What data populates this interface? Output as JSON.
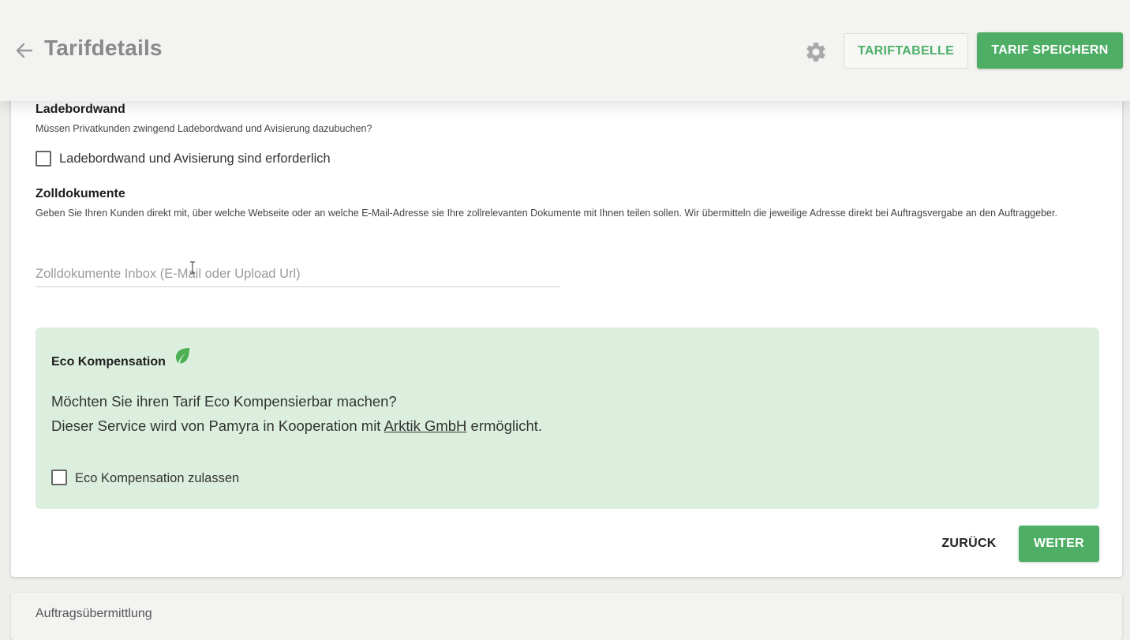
{
  "header": {
    "title": "Tarifdetails",
    "back_icon": "arrow-left-icon",
    "settings_icon": "gear-icon",
    "table_button_label": "TARIFTABELLE",
    "save_button_label": "TARIF SPEICHERN"
  },
  "ladebordwand": {
    "heading": "Ladebordwand",
    "description": "Müssen Privatkunden zwingend Ladebordwand und Avisierung dazubuchen?",
    "checkbox_label": "Ladebordwand und Avisierung sind erforderlich",
    "checked": false
  },
  "zolldokumente": {
    "heading": "Zolldokumente",
    "description": "Geben Sie Ihren Kunden direkt mit, über welche Webseite oder an welche E-Mail-Adresse sie Ihre zollrelevanten Dokumente mit Ihnen teilen sollen. Wir übermitteln die jeweilige Adresse direkt bei Auftragsvergabe an den Auftraggeber.",
    "input_placeholder": "Zolldokumente Inbox (E-Mail oder Upload Url)",
    "input_value": ""
  },
  "eco": {
    "title": "Eco Kompensation",
    "icon": "leaf-icon",
    "question": "Möchten Sie ihren Tarif Eco Kompensierbar machen?",
    "service_prefix": "Dieser Service wird von Pamyra in Kooperation mit ",
    "service_link": "Arktik GmbH",
    "service_suffix": " ermöglicht.",
    "checkbox_label": "Eco Kompensation zulassen",
    "checked": false
  },
  "footer": {
    "back_label": "ZURÜCK",
    "next_label": "WEITER"
  },
  "next_section": {
    "title": "Auftragsübermittlung"
  },
  "colors": {
    "primary": "#4fae65",
    "eco_background": "#dcefdf",
    "title_grey": "#8a8a8a"
  }
}
